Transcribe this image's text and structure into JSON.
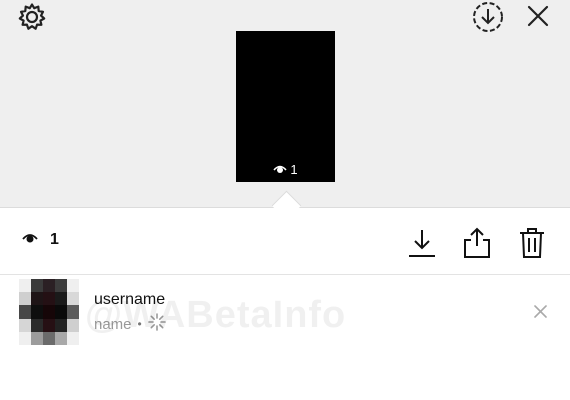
{
  "header": {
    "settings_icon": "gear-icon",
    "download_icon": "circular-download-icon",
    "close_icon": "close-icon"
  },
  "story_preview": {
    "view_count": "1",
    "view_icon": "eye-icon"
  },
  "actions": {
    "view_count": "1",
    "view_icon": "eye-icon",
    "download_icon": "download-icon",
    "share_icon": "share-icon",
    "delete_icon": "trash-icon"
  },
  "viewer": {
    "username": "username",
    "name": "name",
    "separator": "•",
    "status_icon": "loading-spinner-icon",
    "remove_icon": "close-icon"
  },
  "watermark": "@WABetaInfo",
  "colors": {
    "top_background": "#efefef",
    "preview_background": "#000000",
    "icon_color": "#222222",
    "secondary_text": "#9a9a9a"
  }
}
